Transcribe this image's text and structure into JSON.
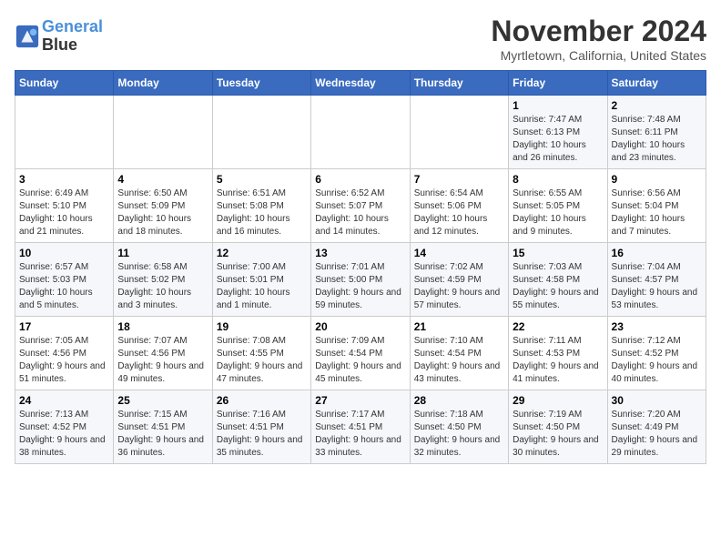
{
  "header": {
    "logo_line1": "General",
    "logo_line2": "Blue",
    "month": "November 2024",
    "location": "Myrtletown, California, United States"
  },
  "days_of_week": [
    "Sunday",
    "Monday",
    "Tuesday",
    "Wednesday",
    "Thursday",
    "Friday",
    "Saturday"
  ],
  "weeks": [
    [
      {
        "day": "",
        "info": ""
      },
      {
        "day": "",
        "info": ""
      },
      {
        "day": "",
        "info": ""
      },
      {
        "day": "",
        "info": ""
      },
      {
        "day": "",
        "info": ""
      },
      {
        "day": "1",
        "info": "Sunrise: 7:47 AM\nSunset: 6:13 PM\nDaylight: 10 hours and 26 minutes."
      },
      {
        "day": "2",
        "info": "Sunrise: 7:48 AM\nSunset: 6:11 PM\nDaylight: 10 hours and 23 minutes."
      }
    ],
    [
      {
        "day": "3",
        "info": "Sunrise: 6:49 AM\nSunset: 5:10 PM\nDaylight: 10 hours and 21 minutes."
      },
      {
        "day": "4",
        "info": "Sunrise: 6:50 AM\nSunset: 5:09 PM\nDaylight: 10 hours and 18 minutes."
      },
      {
        "day": "5",
        "info": "Sunrise: 6:51 AM\nSunset: 5:08 PM\nDaylight: 10 hours and 16 minutes."
      },
      {
        "day": "6",
        "info": "Sunrise: 6:52 AM\nSunset: 5:07 PM\nDaylight: 10 hours and 14 minutes."
      },
      {
        "day": "7",
        "info": "Sunrise: 6:54 AM\nSunset: 5:06 PM\nDaylight: 10 hours and 12 minutes."
      },
      {
        "day": "8",
        "info": "Sunrise: 6:55 AM\nSunset: 5:05 PM\nDaylight: 10 hours and 9 minutes."
      },
      {
        "day": "9",
        "info": "Sunrise: 6:56 AM\nSunset: 5:04 PM\nDaylight: 10 hours and 7 minutes."
      }
    ],
    [
      {
        "day": "10",
        "info": "Sunrise: 6:57 AM\nSunset: 5:03 PM\nDaylight: 10 hours and 5 minutes."
      },
      {
        "day": "11",
        "info": "Sunrise: 6:58 AM\nSunset: 5:02 PM\nDaylight: 10 hours and 3 minutes."
      },
      {
        "day": "12",
        "info": "Sunrise: 7:00 AM\nSunset: 5:01 PM\nDaylight: 10 hours and 1 minute."
      },
      {
        "day": "13",
        "info": "Sunrise: 7:01 AM\nSunset: 5:00 PM\nDaylight: 9 hours and 59 minutes."
      },
      {
        "day": "14",
        "info": "Sunrise: 7:02 AM\nSunset: 4:59 PM\nDaylight: 9 hours and 57 minutes."
      },
      {
        "day": "15",
        "info": "Sunrise: 7:03 AM\nSunset: 4:58 PM\nDaylight: 9 hours and 55 minutes."
      },
      {
        "day": "16",
        "info": "Sunrise: 7:04 AM\nSunset: 4:57 PM\nDaylight: 9 hours and 53 minutes."
      }
    ],
    [
      {
        "day": "17",
        "info": "Sunrise: 7:05 AM\nSunset: 4:56 PM\nDaylight: 9 hours and 51 minutes."
      },
      {
        "day": "18",
        "info": "Sunrise: 7:07 AM\nSunset: 4:56 PM\nDaylight: 9 hours and 49 minutes."
      },
      {
        "day": "19",
        "info": "Sunrise: 7:08 AM\nSunset: 4:55 PM\nDaylight: 9 hours and 47 minutes."
      },
      {
        "day": "20",
        "info": "Sunrise: 7:09 AM\nSunset: 4:54 PM\nDaylight: 9 hours and 45 minutes."
      },
      {
        "day": "21",
        "info": "Sunrise: 7:10 AM\nSunset: 4:54 PM\nDaylight: 9 hours and 43 minutes."
      },
      {
        "day": "22",
        "info": "Sunrise: 7:11 AM\nSunset: 4:53 PM\nDaylight: 9 hours and 41 minutes."
      },
      {
        "day": "23",
        "info": "Sunrise: 7:12 AM\nSunset: 4:52 PM\nDaylight: 9 hours and 40 minutes."
      }
    ],
    [
      {
        "day": "24",
        "info": "Sunrise: 7:13 AM\nSunset: 4:52 PM\nDaylight: 9 hours and 38 minutes."
      },
      {
        "day": "25",
        "info": "Sunrise: 7:15 AM\nSunset: 4:51 PM\nDaylight: 9 hours and 36 minutes."
      },
      {
        "day": "26",
        "info": "Sunrise: 7:16 AM\nSunset: 4:51 PM\nDaylight: 9 hours and 35 minutes."
      },
      {
        "day": "27",
        "info": "Sunrise: 7:17 AM\nSunset: 4:51 PM\nDaylight: 9 hours and 33 minutes."
      },
      {
        "day": "28",
        "info": "Sunrise: 7:18 AM\nSunset: 4:50 PM\nDaylight: 9 hours and 32 minutes."
      },
      {
        "day": "29",
        "info": "Sunrise: 7:19 AM\nSunset: 4:50 PM\nDaylight: 9 hours and 30 minutes."
      },
      {
        "day": "30",
        "info": "Sunrise: 7:20 AM\nSunset: 4:49 PM\nDaylight: 9 hours and 29 minutes."
      }
    ]
  ]
}
